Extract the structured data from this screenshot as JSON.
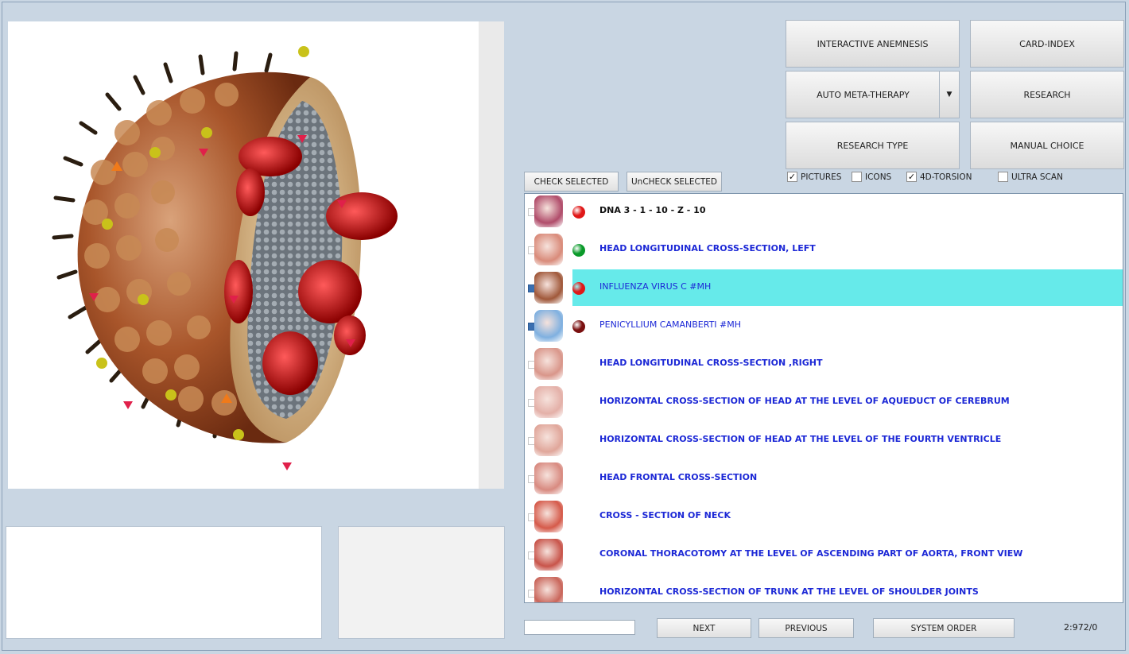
{
  "buttons": {
    "interactive_anemnesis": "INTERACTIVE ANEMNESIS",
    "card_index": "CARD-INDEX",
    "auto_meta_therapy": "AUTO META-THERAPY",
    "research": "RESEARCH",
    "research_type": "RESEARCH TYPE",
    "manual_choice": "MANUAL CHOICE",
    "check_selected": "CHECK SELECTED",
    "uncheck_selected": "UnCHECK SELECTED",
    "next": "NEXT",
    "previous": "PREVIOUS",
    "system_order": "SYSTEM ORDER"
  },
  "options": {
    "pictures": {
      "label": "PICTURES",
      "checked": true
    },
    "icons": {
      "label": "ICONS",
      "checked": false
    },
    "torsion": {
      "label": "4D-TORSION",
      "checked": true
    },
    "ultra_scan": {
      "label": "ULTRA SCAN",
      "checked": false
    }
  },
  "list": [
    {
      "label": "DNA 3 - 1 - 10 - Z - 10",
      "checked": false,
      "dot": "#e01818",
      "thumb": "#b04c6a",
      "style": "black"
    },
    {
      "label": "HEAD LONGITUDINAL CROSS-SECTION, LEFT",
      "checked": false,
      "dot": "#0a9a2a",
      "thumb": "#d98b7a",
      "style": "blue"
    },
    {
      "label": "INFLUENZA VIRUS C #MH",
      "checked": true,
      "dot": "#e01818",
      "thumb": "#a0583a",
      "style": "blue-normal",
      "selected": true
    },
    {
      "label": "PENICYLLIUM CAMANBERTI #MH",
      "checked": true,
      "dot": "#7a1010",
      "thumb": "#7fb0e0",
      "style": "blue-normal"
    },
    {
      "label": "HEAD LONGITUDINAL CROSS-SECTION ,RIGHT",
      "checked": false,
      "dot": "",
      "thumb": "#d9968a",
      "style": "blue"
    },
    {
      "label": "HORIZONTAL CROSS-SECTION OF HEAD AT THE LEVEL OF AQUEDUCT OF CEREBRUM",
      "checked": false,
      "dot": "",
      "thumb": "#e4b0a8",
      "style": "blue"
    },
    {
      "label": "HORIZONTAL CROSS-SECTION OF HEAD AT THE LEVEL OF THE FOURTH VENTRICLE",
      "checked": false,
      "dot": "",
      "thumb": "#e0a69a",
      "style": "blue"
    },
    {
      "label": "HEAD FRONTAL CROSS-SECTION",
      "checked": false,
      "dot": "",
      "thumb": "#d88a80",
      "style": "blue"
    },
    {
      "label": "CROSS - SECTION  OF  NECK",
      "checked": false,
      "dot": "",
      "thumb": "#d55a4a",
      "style": "blue"
    },
    {
      "label": "CORONAL THORACOTOMY AT THE LEVEL OF ASCENDING PART OF AORTA, FRONT VIEW",
      "checked": false,
      "dot": "",
      "thumb": "#c8544a",
      "style": "blue"
    },
    {
      "label": "HORIZONTAL CROSS-SECTION OF TRUNK AT THE LEVEL OF SHOULDER JOINTS",
      "checked": false,
      "dot": "",
      "thumb": "#c9655a",
      "style": "blue"
    }
  ],
  "counter": "2:972/0"
}
